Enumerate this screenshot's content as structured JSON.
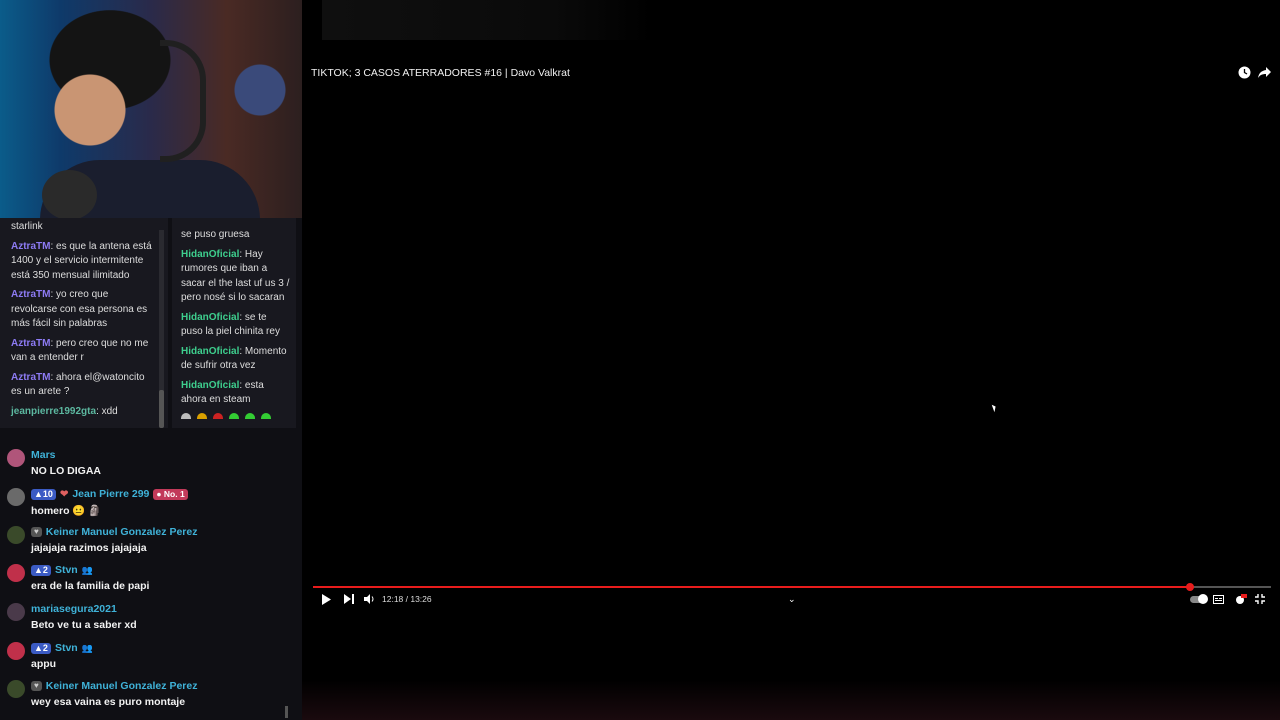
{
  "video": {
    "title": "TIKTOK; 3 CASOS ATERRADORES #16 | Davo Valkrat",
    "time": "12:18 / 13:26",
    "progress_fraction": 0.915,
    "icons": [
      "clock-icon",
      "share-icon",
      "play-icon",
      "next-icon",
      "volume-icon",
      "chevron-down-icon",
      "autoplay-toggle",
      "subtitles-icon",
      "settings-icon",
      "fullscreen-icon"
    ]
  },
  "chat_a": {
    "messages": [
      {
        "user": "",
        "text": "starlink"
      },
      {
        "user": "AztraTM",
        "text": ": es que la antena está 1400 y el servicio intermitente está 350 mensual ilimitado"
      },
      {
        "user": "AztraTM",
        "text": ": yo creo que revolcarse con esa persona es más fácil sin palabras"
      },
      {
        "user": "AztraTM",
        "text": ": pero creo que no me van a entender r"
      },
      {
        "user": "AztraTM",
        "text": ": ahora el@watoncito es un arete ?"
      },
      {
        "user": "jeanpierre1992gta",
        "text": ": xdd"
      }
    ]
  },
  "chat_b": {
    "messages": [
      {
        "user": "",
        "text": "se puso gruesa"
      },
      {
        "user": "HidanOficial",
        "text": ": Hay rumores que iban a sacar el the last uf us 3 / pero nosé si lo sacaran"
      },
      {
        "user": "HidanOficial",
        "text": ": se te puso la piel chinita rey"
      },
      {
        "user": "HidanOficial",
        "text": ": Momento de sufrir otra vez"
      },
      {
        "user": "HidanOficial",
        "text": ": esta ahora en steam"
      }
    ]
  },
  "chat_main": {
    "messages": [
      {
        "user": "Mars",
        "text": "NO LO DIGAA",
        "level": "",
        "badge": "",
        "avatar_color": "#b0557a"
      },
      {
        "user": "Jean Pierre 299",
        "text": "homero 😐 🗿",
        "level": "10",
        "badge": "No. 1",
        "avatar_color": "#6a6a6a"
      },
      {
        "user": "Keiner Manuel Gonzalez Perez",
        "text": "jajajaja razimos jajajaja",
        "level": "",
        "badge": "",
        "avatar_color": "#3a4a2a"
      },
      {
        "user": "Stvn",
        "text": "era de la familia de papi",
        "level": "2",
        "badge": "",
        "avatar_color": "#c0304a"
      },
      {
        "user": "mariasegura2021",
        "text": "Beto ve tu a saber xd",
        "level": "",
        "badge": "",
        "avatar_color": "#4a3a4a"
      },
      {
        "user": "Stvn",
        "text": "appu",
        "level": "2",
        "badge": "",
        "avatar_color": "#c0304a"
      },
      {
        "user": "Keiner Manuel Gonzalez Perez",
        "text": "wey esa vaina es puro montaje",
        "level": "",
        "badge": "",
        "avatar_color": "#3a4a2a"
      }
    ]
  }
}
